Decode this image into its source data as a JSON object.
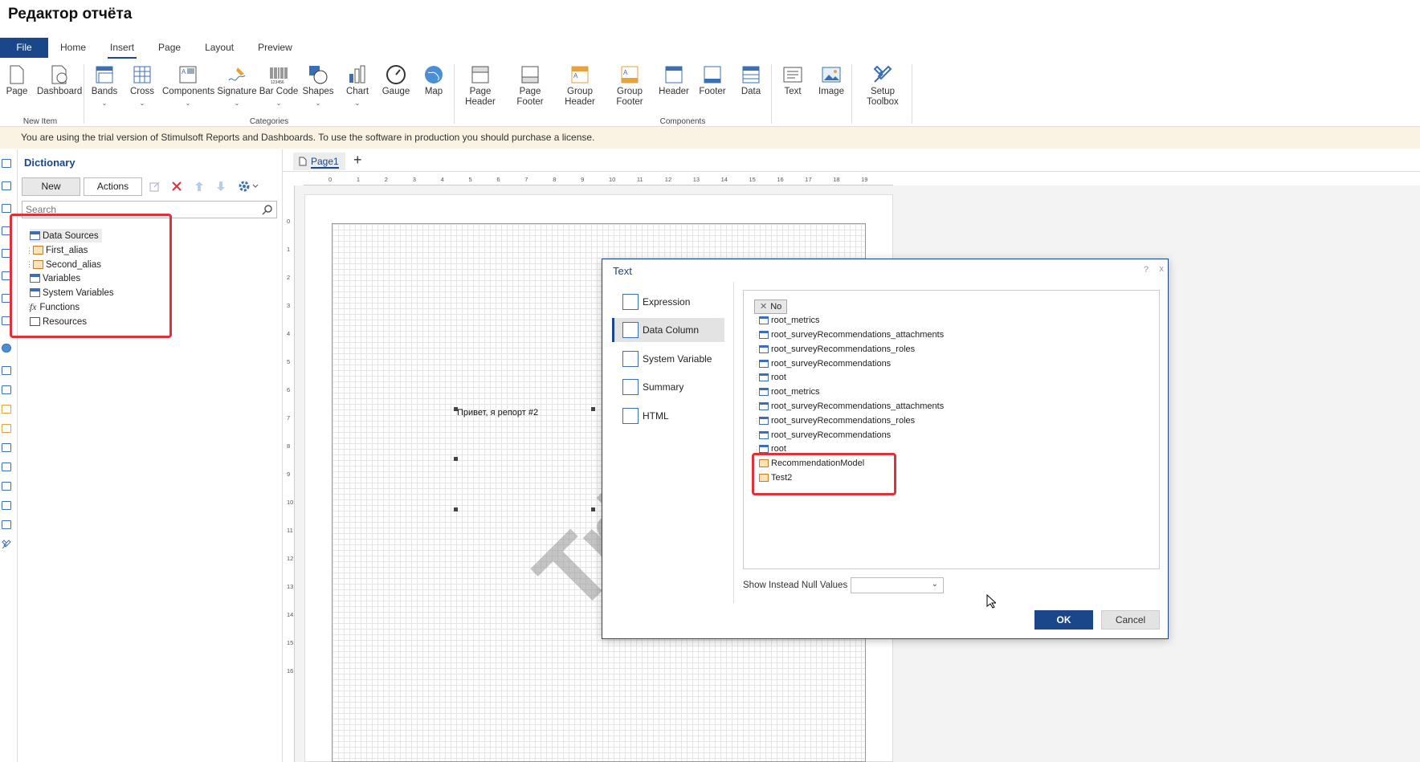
{
  "app_title": "Редактор отчёта",
  "ribbon_tabs": [
    "File",
    "Home",
    "Insert",
    "Page",
    "Layout",
    "Preview"
  ],
  "active_tab": "Insert",
  "ribbon": {
    "new_item": {
      "page": "Page",
      "dashboard": "Dashboard",
      "group": "New Item"
    },
    "categories": {
      "bands": "Bands",
      "cross": "Cross",
      "components": "Components",
      "signature": "Signature",
      "barcode": "Bar Code",
      "shapes": "Shapes",
      "chart": "Chart",
      "gauge": "Gauge",
      "map": "Map",
      "group": "Categories"
    },
    "components": {
      "page_header_1": "Page",
      "page_header_2": "Header",
      "page_footer_1": "Page",
      "page_footer_2": "Footer",
      "group_header_1": "Group",
      "group_header_2": "Header",
      "group_footer_1": "Group",
      "group_footer_2": "Footer",
      "header": "Header",
      "footer": "Footer",
      "data": "Data",
      "group": "Components"
    },
    "text": "Text",
    "image": "Image",
    "setup_toolbox_1": "Setup",
    "setup_toolbox_2": "Toolbox"
  },
  "trial_notice": "You are using the trial version of Stimulsoft Reports and Dashboards. To use the software in production you should purchase a license.",
  "dictionary": {
    "title": "Dictionary",
    "new_label": "New",
    "actions_label": "Actions",
    "search_placeholder": "Search",
    "items": [
      "Data Sources",
      "First_alias",
      "Second_alias",
      "Variables",
      "System Variables",
      "Functions",
      "Resources"
    ],
    "functions_prefix": "fx"
  },
  "page_tab": "Page1",
  "add_tab": "+",
  "ruler_h": [
    "0",
    "1",
    "2",
    "3",
    "4",
    "5",
    "6",
    "7",
    "8",
    "9",
    "10",
    "11",
    "12",
    "13",
    "14",
    "15",
    "16",
    "17",
    "18",
    "19"
  ],
  "ruler_v": [
    "0",
    "1",
    "2",
    "3",
    "4",
    "5",
    "6",
    "7",
    "8",
    "9",
    "10",
    "11",
    "12",
    "13",
    "14",
    "15",
    "16"
  ],
  "component_text": "Привет, я репорт #2",
  "watermark": "Tri",
  "dialog": {
    "title": "Text",
    "help": "?",
    "close": "x",
    "nav": [
      "Expression",
      "Data Column",
      "System Variable",
      "Summary",
      "HTML"
    ],
    "selected_nav": "Data Column",
    "no_label": "No",
    "tree": [
      "root_metrics",
      "root_surveyRecommendations_attachments",
      "root_surveyRecommendations_roles",
      "root_surveyRecommendations",
      "root",
      "root_metrics",
      "root_surveyRecommendations_attachments",
      "root_surveyRecommendations_roles",
      "root_surveyRecommendations",
      "root",
      "RecommendationModel",
      "Test2"
    ],
    "null_label": "Show Instead Null Values",
    "ok_label": "OK",
    "cancel_label": "Cancel"
  }
}
